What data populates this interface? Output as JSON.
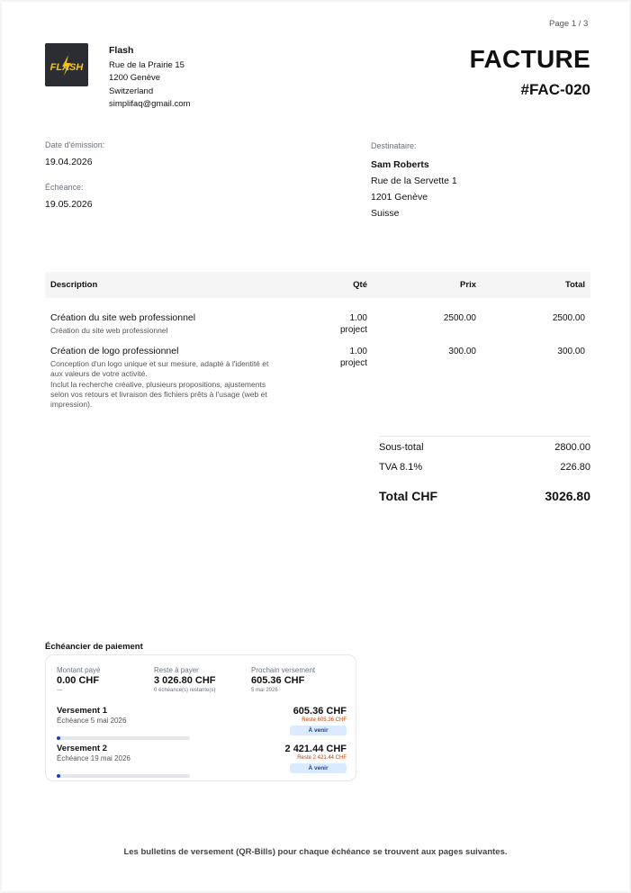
{
  "page_indicator": "Page 1 / 3",
  "sender": {
    "logo_text": "FLASH",
    "name": "Flash",
    "street": "Rue de la Prairie 15",
    "city": "1200 Genève",
    "country": "Switzerland",
    "email": "simplifaq@gmail.com"
  },
  "document": {
    "title": "FACTURE",
    "number": "#FAC-020"
  },
  "dates": {
    "issue_label": "Date d'émission:",
    "issue_value": "19.04.2026",
    "due_label": "Échéance:",
    "due_value": "19.05.2026"
  },
  "recipient": {
    "label": "Destinataire:",
    "name": "Sam Roberts",
    "street": "Rue de la Servette 1",
    "city": "1201 Genève",
    "country": "Suisse"
  },
  "table": {
    "headers": {
      "description": "Description",
      "qty": "Qté",
      "price": "Prix",
      "total": "Total"
    },
    "items": [
      {
        "title": "Création du site web professionnel",
        "subtitle": "Création du site web professionnel",
        "qty": "1.00",
        "unit": "project",
        "price": "2500.00",
        "total": "2500.00"
      },
      {
        "title": "Création de logo professionnel",
        "subtitle": "Conception d'un logo unique et sur mesure, adapté à l'identité et\naux valeurs de votre activité.\nInclut la recherche créative, plusieurs propositions, ajustements\nselon vos retours et livraison des fichiers prêts à l'usage (web et\nimpression).",
        "qty": "1.00",
        "unit": "project",
        "price": "300.00",
        "total": "300.00"
      }
    ]
  },
  "totals": {
    "subtotal_label": "Sous-total",
    "subtotal_value": "2800.00",
    "vat_label": "TVA 8.1%",
    "vat_value": "226.80",
    "total_label": "Total CHF",
    "total_value": "3026.80"
  },
  "schedule": {
    "title": "Échéancier de paiement",
    "paid_label": "Montant payé",
    "paid_value": "0.00 CHF",
    "paid_note": "—",
    "remaining_label": "Reste à payer",
    "remaining_value": "3 026.80 CHF",
    "remaining_note": "0 échéance(s) restante(s)",
    "next_label": "Prochain versement",
    "next_value": "605.36 CHF",
    "next_note": "5 mai 2026",
    "installments": [
      {
        "name": "Versement 1",
        "due": "Échéance 5 mai 2026",
        "amount": "605.36 CHF",
        "remaining": "Reste 605.36 CHF",
        "status": "À venir",
        "paid_fraction": 0
      },
      {
        "name": "Versement 2",
        "due": "Échéance 19 mai 2026",
        "amount": "2 421.44 CHF",
        "remaining": "Reste 2 421.44 CHF",
        "status": "À venir",
        "paid_fraction": 0
      }
    ]
  },
  "footer_note": "Les bulletins de versement (QR-Bills) pour chaque échéance se trouvent aux pages suivantes.",
  "colors": {
    "badge_bg": "#dbeafe",
    "badge_text": "#1e40af",
    "remaining_text": "#c2410c",
    "logo_bg": "#2b2d32",
    "logo_text": "#f5c518"
  }
}
